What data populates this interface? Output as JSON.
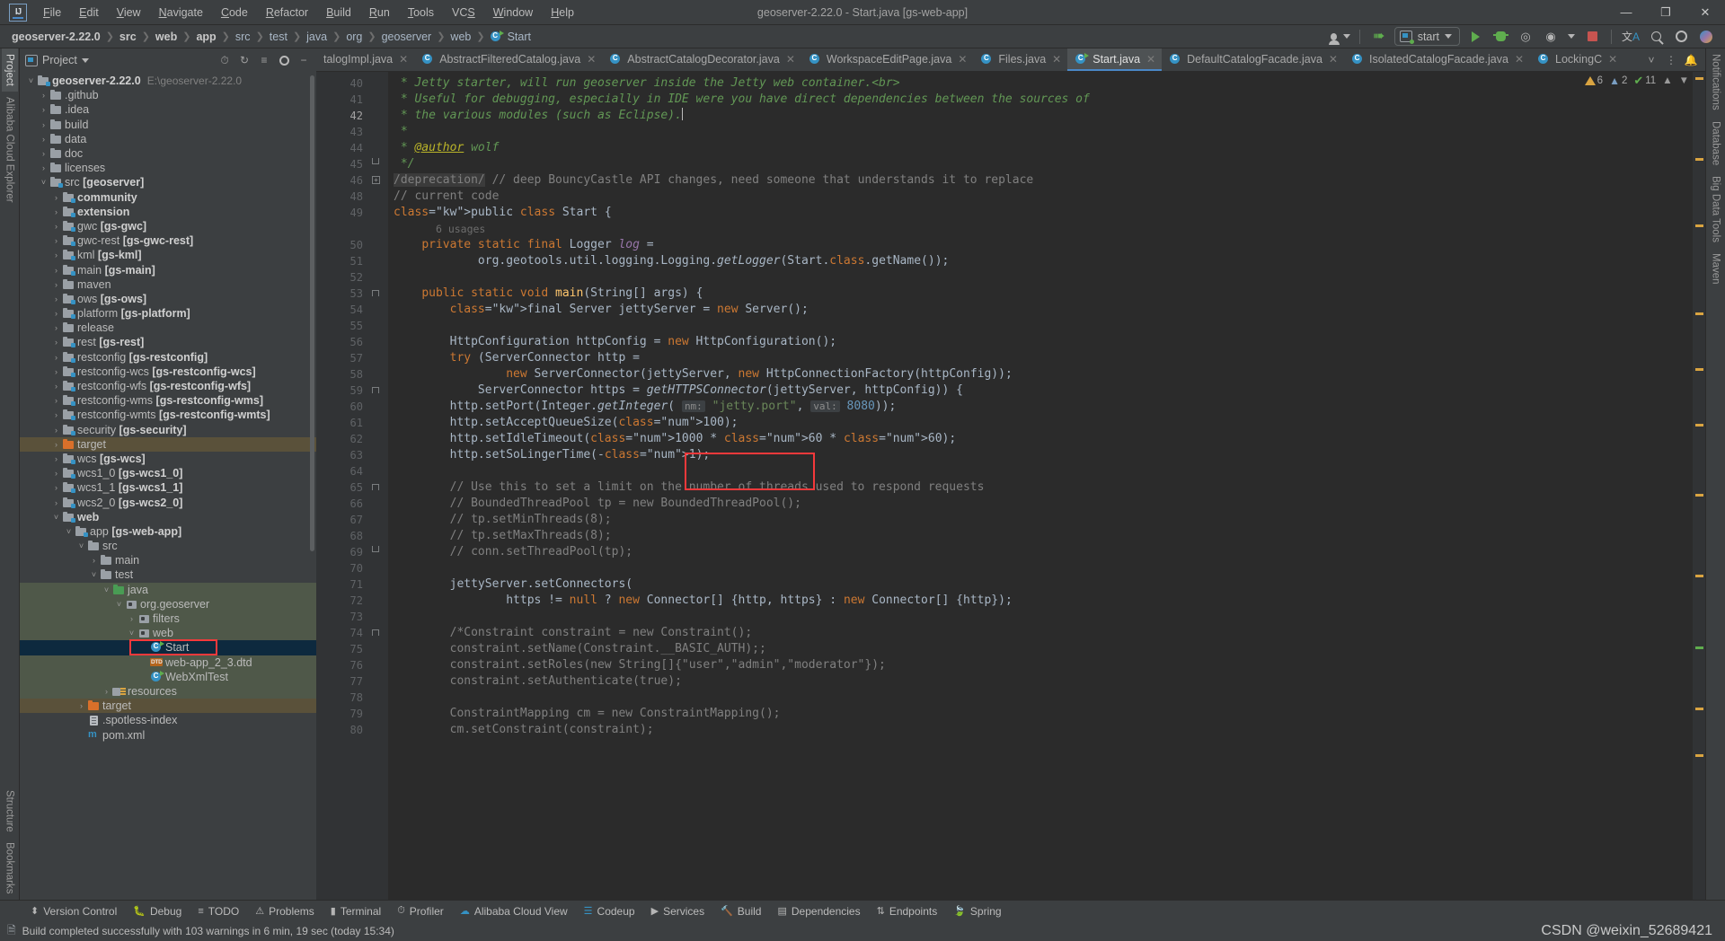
{
  "window": {
    "title": "geoserver-2.22.0 - Start.java [gs-web-app]",
    "minimize": "—",
    "maximize": "❐",
    "close": "✕"
  },
  "menubar": [
    "File",
    "Edit",
    "View",
    "Navigate",
    "Code",
    "Refactor",
    "Build",
    "Run",
    "Tools",
    "VCS",
    "Window",
    "Help"
  ],
  "breadcrumbs": [
    {
      "label": "geoserver-2.22.0",
      "bold": true
    },
    {
      "label": "src",
      "bold": true
    },
    {
      "label": "web",
      "bold": true
    },
    {
      "label": "app",
      "bold": true
    },
    {
      "label": "src",
      "bold": false
    },
    {
      "label": "test",
      "bold": false
    },
    {
      "label": "java",
      "bold": false
    },
    {
      "label": "org",
      "bold": false
    },
    {
      "label": "geoserver",
      "bold": false
    },
    {
      "label": "web",
      "bold": false
    },
    {
      "label": "Start",
      "bold": false,
      "icon": "class-icon"
    }
  ],
  "toolbar": {
    "account_icon": "user-account-icon",
    "updates_icon": "green-arrow-up-icon",
    "run_config": "start",
    "run_icon": "run-icon",
    "debug_icon": "debug-icon",
    "run_with_coverage_icon": "run-with-coverage-icon",
    "profile_icon": "profile-icon",
    "stop_icon": "stop-icon",
    "translate_icon": "translate-icon",
    "search_icon": "search-everywhere-icon",
    "settings_icon": "settings-gear-icon",
    "ai_icon": "ai-assistant-icon"
  },
  "left_strip": [
    {
      "label": "Project",
      "icon": "project-icon",
      "selected": true
    },
    {
      "label": "Alibaba Cloud Explorer",
      "icon": "cloud-icon",
      "selected": false
    },
    {
      "label": "Structure",
      "icon": "structure-icon",
      "selected": false
    },
    {
      "label": "Bookmarks",
      "icon": "bookmarks-icon",
      "selected": false
    }
  ],
  "right_strip": [
    {
      "label": "Notifications",
      "icon": "bell-icon"
    },
    {
      "label": "Database",
      "icon": "database-icon"
    },
    {
      "label": "Big Data Tools",
      "icon": "bigdata-icon"
    },
    {
      "label": "Maven",
      "icon": "maven-icon"
    }
  ],
  "project_panel": {
    "title": "Project",
    "tools": [
      "chevron-down-icon",
      "clock-icon",
      "collapse-all-icon",
      "select-opened-file-icon",
      "settings-gear-icon",
      "hide-icon"
    ],
    "tree": [
      {
        "depth": 0,
        "twist": "open",
        "icon": "module-folder-icon",
        "label": "geoserver-2.22.0",
        "bold": true,
        "path": "E:\\geoserver-2.22.0",
        "state": "normal"
      },
      {
        "depth": 1,
        "twist": "closed",
        "icon": "folder-icon",
        "label": ".github",
        "bold": false,
        "state": "normal"
      },
      {
        "depth": 1,
        "twist": "closed",
        "icon": "folder-icon",
        "label": ".idea",
        "bold": false,
        "state": "normal"
      },
      {
        "depth": 1,
        "twist": "closed",
        "icon": "folder-icon",
        "label": "build",
        "bold": false,
        "state": "normal"
      },
      {
        "depth": 1,
        "twist": "closed",
        "icon": "folder-icon",
        "label": "data",
        "bold": false,
        "state": "normal"
      },
      {
        "depth": 1,
        "twist": "closed",
        "icon": "folder-icon",
        "label": "doc",
        "bold": false,
        "state": "normal"
      },
      {
        "depth": 1,
        "twist": "closed",
        "icon": "folder-icon",
        "label": "licenses",
        "bold": false,
        "state": "normal"
      },
      {
        "depth": 1,
        "twist": "open",
        "icon": "module-folder-icon",
        "label": "src ",
        "suffix": "[geoserver]",
        "state": "normal"
      },
      {
        "depth": 2,
        "twist": "closed",
        "icon": "module-folder-icon",
        "label": "community",
        "bold": true,
        "state": "normal"
      },
      {
        "depth": 2,
        "twist": "closed",
        "icon": "module-folder-icon",
        "label": "extension",
        "bold": true,
        "state": "normal"
      },
      {
        "depth": 2,
        "twist": "closed",
        "icon": "module-folder-icon",
        "label": "gwc ",
        "suffix": "[gs-gwc]",
        "state": "normal"
      },
      {
        "depth": 2,
        "twist": "closed",
        "icon": "module-folder-icon",
        "label": "gwc-rest ",
        "suffix": "[gs-gwc-rest]",
        "state": "normal"
      },
      {
        "depth": 2,
        "twist": "closed",
        "icon": "module-folder-icon",
        "label": "kml ",
        "suffix": "[gs-kml]",
        "state": "normal"
      },
      {
        "depth": 2,
        "twist": "closed",
        "icon": "module-folder-icon",
        "label": "main ",
        "suffix": "[gs-main]",
        "state": "normal"
      },
      {
        "depth": 2,
        "twist": "closed",
        "icon": "folder-icon",
        "label": "maven",
        "state": "normal"
      },
      {
        "depth": 2,
        "twist": "closed",
        "icon": "module-folder-icon",
        "label": "ows ",
        "suffix": "[gs-ows]",
        "state": "normal"
      },
      {
        "depth": 2,
        "twist": "closed",
        "icon": "module-folder-icon",
        "label": "platform ",
        "suffix": "[gs-platform]",
        "state": "normal"
      },
      {
        "depth": 2,
        "twist": "closed",
        "icon": "folder-icon",
        "label": "release",
        "state": "normal"
      },
      {
        "depth": 2,
        "twist": "closed",
        "icon": "module-folder-icon",
        "label": "rest ",
        "suffix": "[gs-rest]",
        "state": "normal"
      },
      {
        "depth": 2,
        "twist": "closed",
        "icon": "module-folder-icon",
        "label": "restconfig ",
        "suffix": "[gs-restconfig]",
        "state": "normal"
      },
      {
        "depth": 2,
        "twist": "closed",
        "icon": "module-folder-icon",
        "label": "restconfig-wcs ",
        "suffix": "[gs-restconfig-wcs]",
        "state": "normal"
      },
      {
        "depth": 2,
        "twist": "closed",
        "icon": "module-folder-icon",
        "label": "restconfig-wfs ",
        "suffix": "[gs-restconfig-wfs]",
        "state": "normal"
      },
      {
        "depth": 2,
        "twist": "closed",
        "icon": "module-folder-icon",
        "label": "restconfig-wms ",
        "suffix": "[gs-restconfig-wms]",
        "state": "normal"
      },
      {
        "depth": 2,
        "twist": "closed",
        "icon": "module-folder-icon",
        "label": "restconfig-wmts ",
        "suffix": "[gs-restconfig-wmts]",
        "state": "normal"
      },
      {
        "depth": 2,
        "twist": "closed",
        "icon": "module-folder-icon",
        "label": "security ",
        "suffix": "[gs-security]",
        "state": "normal"
      },
      {
        "depth": 2,
        "twist": "closed",
        "icon": "folder-orange-icon",
        "label": "target",
        "state": "target"
      },
      {
        "depth": 2,
        "twist": "closed",
        "icon": "module-folder-icon",
        "label": "wcs ",
        "suffix": "[gs-wcs]",
        "state": "normal"
      },
      {
        "depth": 2,
        "twist": "closed",
        "icon": "module-folder-icon",
        "label": "wcs1_0 ",
        "suffix": "[gs-wcs1_0]",
        "state": "normal"
      },
      {
        "depth": 2,
        "twist": "closed",
        "icon": "module-folder-icon",
        "label": "wcs1_1 ",
        "suffix": "[gs-wcs1_1]",
        "state": "normal"
      },
      {
        "depth": 2,
        "twist": "closed",
        "icon": "module-folder-icon",
        "label": "wcs2_0 ",
        "suffix": "[gs-wcs2_0]",
        "state": "normal"
      },
      {
        "depth": 2,
        "twist": "open",
        "icon": "module-folder-icon",
        "label": "web",
        "bold": true,
        "state": "normal"
      },
      {
        "depth": 3,
        "twist": "open",
        "icon": "module-folder-icon",
        "label": "app ",
        "suffix": "[gs-web-app]",
        "state": "normal"
      },
      {
        "depth": 4,
        "twist": "open",
        "icon": "folder-icon",
        "label": "src",
        "state": "normal"
      },
      {
        "depth": 5,
        "twist": "closed",
        "icon": "folder-icon",
        "label": "main",
        "state": "normal"
      },
      {
        "depth": 5,
        "twist": "open",
        "icon": "folder-icon",
        "label": "test",
        "state": "normal"
      },
      {
        "depth": 6,
        "twist": "open",
        "icon": "test-source-folder-icon",
        "label": "java",
        "state": "srcroot"
      },
      {
        "depth": 7,
        "twist": "open",
        "icon": "package-icon",
        "label": "org.geoserver",
        "state": "srcroot"
      },
      {
        "depth": 8,
        "twist": "closed",
        "icon": "package-icon",
        "label": "filters",
        "state": "srcroot"
      },
      {
        "depth": 8,
        "twist": "open",
        "icon": "package-icon",
        "label": "web",
        "state": "srcroot"
      },
      {
        "depth": 9,
        "twist": "none",
        "icon": "runnable-class-icon",
        "label": "Start",
        "state": "selected"
      },
      {
        "depth": 9,
        "twist": "none",
        "icon": "dtd-file-icon",
        "label": "web-app_2_3.dtd",
        "state": "srcroot"
      },
      {
        "depth": 9,
        "twist": "none",
        "icon": "runnable-class-icon",
        "label": "WebXmlTest",
        "state": "srcroot"
      },
      {
        "depth": 6,
        "twist": "closed",
        "icon": "resources-folder-icon",
        "label": "resources",
        "state": "srcroot"
      },
      {
        "depth": 4,
        "twist": "closed",
        "icon": "folder-orange-icon",
        "label": "target",
        "state": "target"
      },
      {
        "depth": 4,
        "twist": "none",
        "icon": "file-icon",
        "label": ".spotless-index",
        "state": "normal"
      },
      {
        "depth": 4,
        "twist": "none",
        "icon": "maven-xml-icon",
        "label": "pom.xml",
        "state": "normal"
      }
    ]
  },
  "editor_tabs": [
    {
      "label": "talogImpl.java",
      "icon": "class-icon",
      "active": false,
      "truncated": true
    },
    {
      "label": "AbstractFilteredCatalog.java",
      "icon": "abstract-class-icon",
      "active": false
    },
    {
      "label": "AbstractCatalogDecorator.java",
      "icon": "class-icon",
      "active": false
    },
    {
      "label": "WorkspaceEditPage.java",
      "icon": "class-icon",
      "active": false
    },
    {
      "label": "Files.java",
      "icon": "class-icon",
      "active": false
    },
    {
      "label": "Start.java",
      "icon": "runnable-class-icon",
      "active": true
    },
    {
      "label": "DefaultCatalogFacade.java",
      "icon": "class-icon",
      "active": false
    },
    {
      "label": "IsolatedCatalogFacade.java",
      "icon": "class-icon",
      "active": false
    },
    {
      "label": "LockingC",
      "icon": "class-icon",
      "active": false,
      "truncated": true
    }
  ],
  "inspections": {
    "warnings": "6",
    "weak_warnings": "2",
    "typos": "11",
    "up_icon": "chevron-up-icon",
    "down_icon": "chevron-down-icon"
  },
  "code": {
    "file": "Start.java",
    "first_line": 40,
    "caret_line": 42,
    "usages_label": "6 usages",
    "lines": [
      {
        "n": 40,
        "t": "comment",
        "text": " * Jetty starter, will run geoserver inside the Jetty web container.<br>"
      },
      {
        "n": 41,
        "t": "comment",
        "text": " * Useful for debugging, especially in IDE were you have direct dependencies between the sources of"
      },
      {
        "n": 42,
        "t": "comment",
        "text": " * the various modules (such as Eclipse).",
        "caret": true
      },
      {
        "n": 43,
        "t": "comment",
        "text": " *"
      },
      {
        "n": 44,
        "t": "comment-author",
        "text": " * @author wolf"
      },
      {
        "n": 45,
        "t": "comment",
        "text": " */",
        "fold": "end"
      },
      {
        "n": 46,
        "t": "folded",
        "text": "/deprecation/ // deep BouncyCastle API changes, need someone that understands it to replace",
        "fold": "plus"
      },
      {
        "n": 48,
        "t": "line-comment",
        "text": "// current code"
      },
      {
        "n": 49,
        "t": "code",
        "text": "public class Start {",
        "run_marker": true
      },
      {
        "n": null,
        "t": "usages",
        "text": "6 usages"
      },
      {
        "n": 50,
        "t": "code",
        "text": "    private static final Logger log ="
      },
      {
        "n": 51,
        "t": "code",
        "text": "            org.geotools.util.logging.Logging.getLogger(Start.class.getName());"
      },
      {
        "n": 52,
        "t": "code",
        "text": ""
      },
      {
        "n": 53,
        "t": "code",
        "text": "    public static void main(String[] args) {",
        "run_marker": true,
        "fold": "start"
      },
      {
        "n": 54,
        "t": "code",
        "text": "        final Server jettyServer = new Server();"
      },
      {
        "n": 55,
        "t": "code",
        "text": ""
      },
      {
        "n": 56,
        "t": "code",
        "text": "        HttpConfiguration httpConfig = new HttpConfiguration();"
      },
      {
        "n": 57,
        "t": "code",
        "text": "        try (ServerConnector http ="
      },
      {
        "n": 58,
        "t": "code",
        "text": "                new ServerConnector(jettyServer, new HttpConnectionFactory(httpConfig));"
      },
      {
        "n": 59,
        "t": "code",
        "text": "            ServerConnector https = getHTTPSConnector(jettyServer, httpConfig)) {",
        "fold": "start"
      },
      {
        "n": 60,
        "t": "code",
        "text": "        http.setPort(Integer.getInteger( nm: \"jetty.port\",  val: 8080));",
        "highlight": true
      },
      {
        "n": 61,
        "t": "code",
        "text": "        http.setAcceptQueueSize(100);"
      },
      {
        "n": 62,
        "t": "code",
        "text": "        http.setIdleTimeout(1000 * 60 * 60);"
      },
      {
        "n": 63,
        "t": "code",
        "text": "        http.setSoLingerTime(-1);"
      },
      {
        "n": 64,
        "t": "code",
        "text": ""
      },
      {
        "n": 65,
        "t": "line-comment",
        "text": "        // Use this to set a limit on the number of threads used to respond requests",
        "fold": "start"
      },
      {
        "n": 66,
        "t": "line-comment",
        "text": "        // BoundedThreadPool tp = new BoundedThreadPool();"
      },
      {
        "n": 67,
        "t": "line-comment",
        "text": "        // tp.setMinThreads(8);"
      },
      {
        "n": 68,
        "t": "line-comment",
        "text": "        // tp.setMaxThreads(8);"
      },
      {
        "n": 69,
        "t": "line-comment",
        "text": "        // conn.setThreadPool(tp);",
        "fold": "end"
      },
      {
        "n": 70,
        "t": "code",
        "text": ""
      },
      {
        "n": 71,
        "t": "code",
        "text": "        jettyServer.setConnectors("
      },
      {
        "n": 72,
        "t": "code",
        "text": "                https != null ? new Connector[] {http, https} : new Connector[] {http});"
      },
      {
        "n": 73,
        "t": "code",
        "text": ""
      },
      {
        "n": 74,
        "t": "block-comment",
        "text": "        /*Constraint constraint = new Constraint();",
        "fold": "start"
      },
      {
        "n": 75,
        "t": "block-comment",
        "text": "        constraint.setName(Constraint.__BASIC_AUTH);;"
      },
      {
        "n": 76,
        "t": "block-comment",
        "text": "        constraint.setRoles(new String[]{\"user\",\"admin\",\"moderator\"});"
      },
      {
        "n": 77,
        "t": "block-comment",
        "text": "        constraint.setAuthenticate(true);"
      },
      {
        "n": 78,
        "t": "block-comment",
        "text": ""
      },
      {
        "n": 79,
        "t": "block-comment",
        "text": "        ConstraintMapping cm = new ConstraintMapping();"
      },
      {
        "n": 80,
        "t": "block-comment",
        "text": "        cm.setConstraint(constraint);"
      }
    ],
    "annotation_note": "red-highlight-box-around-port-8080"
  },
  "tool_windows": [
    {
      "label": "Version Control",
      "icon": "branch-icon"
    },
    {
      "label": "Debug",
      "icon": "debug-icon"
    },
    {
      "label": "TODO",
      "icon": "todo-list-icon"
    },
    {
      "label": "Problems",
      "icon": "problems-icon"
    },
    {
      "label": "Terminal",
      "icon": "terminal-icon"
    },
    {
      "label": "Profiler",
      "icon": "profiler-icon"
    },
    {
      "label": "Alibaba Cloud View",
      "icon": "alibaba-cloud-icon"
    },
    {
      "label": "Codeup",
      "icon": "codeup-icon"
    },
    {
      "label": "Services",
      "icon": "services-icon"
    },
    {
      "label": "Build",
      "icon": "build-hammer-icon"
    },
    {
      "label": "Dependencies",
      "icon": "dependencies-icon"
    },
    {
      "label": "Endpoints",
      "icon": "endpoints-icon"
    },
    {
      "label": "Spring",
      "icon": "spring-leaf-icon"
    }
  ],
  "statusbar": {
    "icon": "build-status-icon",
    "message": "Build completed successfully with 103 warnings in 6 min, 19 sec (today 15:34)"
  },
  "watermark": "CSDN @weixin_52689421",
  "colors": {
    "accent": "#4a88c7",
    "run_green": "#5fad4e",
    "error_red": "#c75450",
    "warning_yellow": "#d9a441",
    "annotation_red": "#f4393b",
    "editor_bg": "#2b2b2b",
    "panel_bg": "#3c3f41",
    "selection_blue": "#0d293e",
    "source_root_green": "#4f5849",
    "target_brown": "#5a513a"
  }
}
